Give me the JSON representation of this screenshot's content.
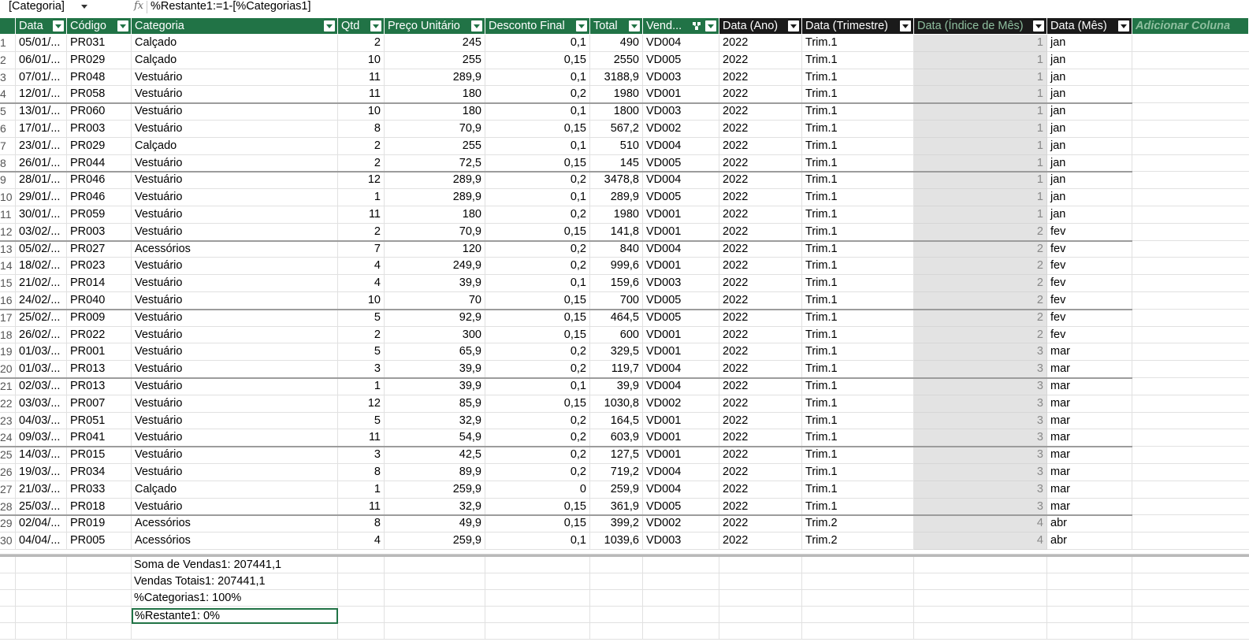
{
  "formula_bar": {
    "name_box": "[Categoria]",
    "fx_label": "fx",
    "formula": "%Restante1:=1-[%Categorias1]"
  },
  "columns": [
    {
      "key": "data",
      "label": "Data"
    },
    {
      "key": "codigo",
      "label": "Código"
    },
    {
      "key": "categoria",
      "label": "Categoria"
    },
    {
      "key": "qtd",
      "label": "Qtd"
    },
    {
      "key": "preco",
      "label": "Preço Unitário"
    },
    {
      "key": "desconto",
      "label": "Desconto Final"
    },
    {
      "key": "total",
      "label": "Total"
    },
    {
      "key": "vend",
      "label": "Vend..."
    },
    {
      "key": "ano",
      "label": "Data (Ano)"
    },
    {
      "key": "trim",
      "label": "Data (Trimestre)"
    },
    {
      "key": "idx",
      "label": "Data (Índice de Mês)"
    },
    {
      "key": "mes",
      "label": "Data (Mês)"
    },
    {
      "key": "add",
      "label": "Adicionar Coluna"
    }
  ],
  "rows": [
    [
      "1",
      "05/01/...",
      "PR031",
      "Calçado",
      "2",
      "245",
      "0,1",
      "490",
      "VD004",
      "2022",
      "Trim.1",
      "1",
      "jan"
    ],
    [
      "2",
      "06/01/...",
      "PR029",
      "Calçado",
      "10",
      "255",
      "0,15",
      "2550",
      "VD005",
      "2022",
      "Trim.1",
      "1",
      "jan"
    ],
    [
      "3",
      "07/01/...",
      "PR048",
      "Vestuário",
      "11",
      "289,9",
      "0,1",
      "3188,9",
      "VD003",
      "2022",
      "Trim.1",
      "1",
      "jan"
    ],
    [
      "4",
      "12/01/...",
      "PR058",
      "Vestuário",
      "11",
      "180",
      "0,2",
      "1980",
      "VD001",
      "2022",
      "Trim.1",
      "1",
      "jan"
    ],
    [
      "5",
      "13/01/...",
      "PR060",
      "Vestuário",
      "10",
      "180",
      "0,1",
      "1800",
      "VD003",
      "2022",
      "Trim.1",
      "1",
      "jan"
    ],
    [
      "6",
      "17/01/...",
      "PR003",
      "Vestuário",
      "8",
      "70,9",
      "0,15",
      "567,2",
      "VD002",
      "2022",
      "Trim.1",
      "1",
      "jan"
    ],
    [
      "7",
      "23/01/...",
      "PR029",
      "Calçado",
      "2",
      "255",
      "0,1",
      "510",
      "VD004",
      "2022",
      "Trim.1",
      "1",
      "jan"
    ],
    [
      "8",
      "26/01/...",
      "PR044",
      "Vestuário",
      "2",
      "72,5",
      "0,15",
      "145",
      "VD005",
      "2022",
      "Trim.1",
      "1",
      "jan"
    ],
    [
      "9",
      "28/01/...",
      "PR046",
      "Vestuário",
      "12",
      "289,9",
      "0,2",
      "3478,8",
      "VD004",
      "2022",
      "Trim.1",
      "1",
      "jan"
    ],
    [
      "10",
      "29/01/...",
      "PR046",
      "Vestuário",
      "1",
      "289,9",
      "0,1",
      "289,9",
      "VD005",
      "2022",
      "Trim.1",
      "1",
      "jan"
    ],
    [
      "11",
      "30/01/...",
      "PR059",
      "Vestuário",
      "11",
      "180",
      "0,2",
      "1980",
      "VD001",
      "2022",
      "Trim.1",
      "1",
      "jan"
    ],
    [
      "12",
      "03/02/...",
      "PR003",
      "Vestuário",
      "2",
      "70,9",
      "0,15",
      "141,8",
      "VD001",
      "2022",
      "Trim.1",
      "2",
      "fev"
    ],
    [
      "13",
      "05/02/...",
      "PR027",
      "Acessórios",
      "7",
      "120",
      "0,2",
      "840",
      "VD004",
      "2022",
      "Trim.1",
      "2",
      "fev"
    ],
    [
      "14",
      "18/02/...",
      "PR023",
      "Vestuário",
      "4",
      "249,9",
      "0,2",
      "999,6",
      "VD001",
      "2022",
      "Trim.1",
      "2",
      "fev"
    ],
    [
      "15",
      "21/02/...",
      "PR014",
      "Vestuário",
      "4",
      "39,9",
      "0,1",
      "159,6",
      "VD003",
      "2022",
      "Trim.1",
      "2",
      "fev"
    ],
    [
      "16",
      "24/02/...",
      "PR040",
      "Vestuário",
      "10",
      "70",
      "0,15",
      "700",
      "VD005",
      "2022",
      "Trim.1",
      "2",
      "fev"
    ],
    [
      "17",
      "25/02/...",
      "PR009",
      "Vestuário",
      "5",
      "92,9",
      "0,15",
      "464,5",
      "VD005",
      "2022",
      "Trim.1",
      "2",
      "fev"
    ],
    [
      "18",
      "26/02/...",
      "PR022",
      "Vestuário",
      "2",
      "300",
      "0,15",
      "600",
      "VD001",
      "2022",
      "Trim.1",
      "2",
      "fev"
    ],
    [
      "19",
      "01/03/...",
      "PR001",
      "Vestuário",
      "5",
      "65,9",
      "0,2",
      "329,5",
      "VD001",
      "2022",
      "Trim.1",
      "3",
      "mar"
    ],
    [
      "20",
      "01/03/...",
      "PR013",
      "Vestuário",
      "3",
      "39,9",
      "0,2",
      "119,7",
      "VD004",
      "2022",
      "Trim.1",
      "3",
      "mar"
    ],
    [
      "21",
      "02/03/...",
      "PR013",
      "Vestuário",
      "1",
      "39,9",
      "0,1",
      "39,9",
      "VD004",
      "2022",
      "Trim.1",
      "3",
      "mar"
    ],
    [
      "22",
      "03/03/...",
      "PR007",
      "Vestuário",
      "12",
      "85,9",
      "0,15",
      "1030,8",
      "VD002",
      "2022",
      "Trim.1",
      "3",
      "mar"
    ],
    [
      "23",
      "04/03/...",
      "PR051",
      "Vestuário",
      "5",
      "32,9",
      "0,2",
      "164,5",
      "VD001",
      "2022",
      "Trim.1",
      "3",
      "mar"
    ],
    [
      "24",
      "09/03/...",
      "PR041",
      "Vestuário",
      "11",
      "54,9",
      "0,2",
      "603,9",
      "VD001",
      "2022",
      "Trim.1",
      "3",
      "mar"
    ],
    [
      "25",
      "14/03/...",
      "PR015",
      "Vestuário",
      "3",
      "42,5",
      "0,2",
      "127,5",
      "VD001",
      "2022",
      "Trim.1",
      "3",
      "mar"
    ],
    [
      "26",
      "19/03/...",
      "PR034",
      "Vestuário",
      "8",
      "89,9",
      "0,2",
      "719,2",
      "VD004",
      "2022",
      "Trim.1",
      "3",
      "mar"
    ],
    [
      "27",
      "21/03/...",
      "PR033",
      "Calçado",
      "1",
      "259,9",
      "0",
      "259,9",
      "VD004",
      "2022",
      "Trim.1",
      "3",
      "mar"
    ],
    [
      "28",
      "25/03/...",
      "PR018",
      "Vestuário",
      "11",
      "32,9",
      "0,15",
      "361,9",
      "VD005",
      "2022",
      "Trim.1",
      "3",
      "mar"
    ],
    [
      "29",
      "02/04/...",
      "PR019",
      "Acessórios",
      "8",
      "49,9",
      "0,15",
      "399,2",
      "VD002",
      "2022",
      "Trim.2",
      "4",
      "abr"
    ],
    [
      "30",
      "04/04/...",
      "PR005",
      "Acessórios",
      "4",
      "259,9",
      "0,1",
      "1039,6",
      "VD003",
      "2022",
      "Trim.2",
      "4",
      "abr"
    ]
  ],
  "measures": [
    {
      "label": "Soma de Vendas1: 207441,1"
    },
    {
      "label": "Vendas Totais1: 207441,1"
    },
    {
      "label": "%Categorias1: 100%"
    },
    {
      "label": "%Restante1: 0%"
    }
  ],
  "colors": {
    "header_green": "#217346",
    "header_dark": "#1a1a1a",
    "calc_column_shade": "#e3e3e3",
    "selection_border": "#217346"
  }
}
